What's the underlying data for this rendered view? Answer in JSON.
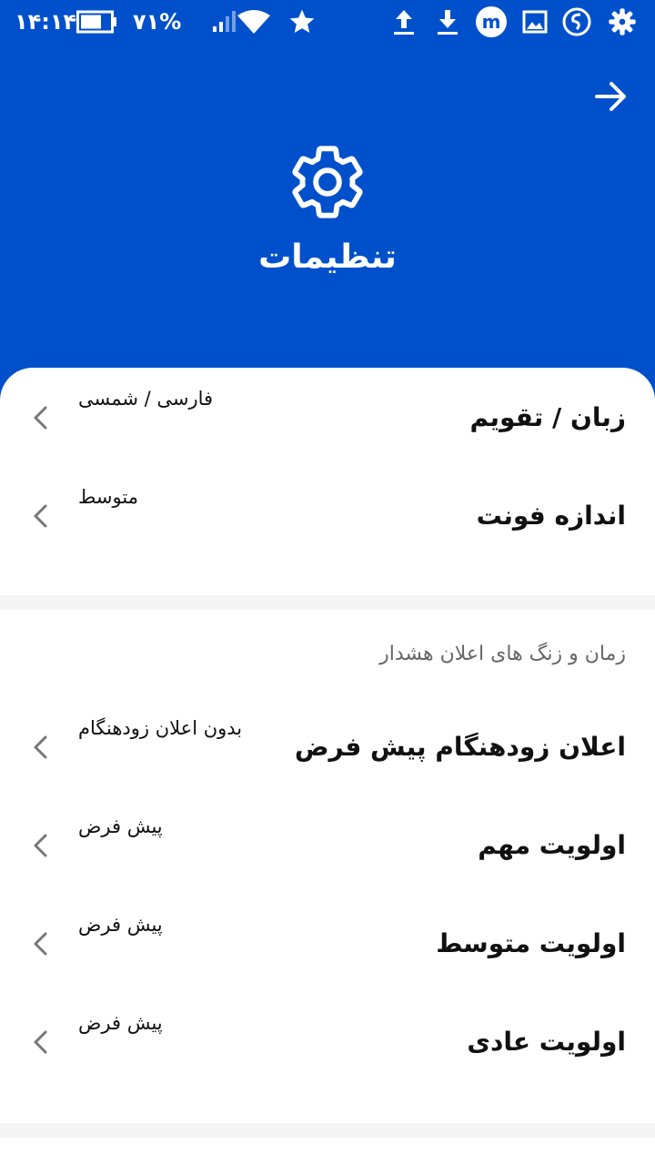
{
  "status_bar": {
    "time": "۱۴:۱۴",
    "battery_percent": "۷۱%",
    "battery_level": 0.71,
    "icons": [
      "battery-icon",
      "signal-icon",
      "wifi-icon",
      "star-icon",
      "upload-icon",
      "download-icon",
      "app-m-icon",
      "image-icon",
      "app-s-icon",
      "settings-cog-icon"
    ]
  },
  "header": {
    "title": "تنظیمات",
    "back_icon": "arrow-right-icon",
    "icon": "gear-icon",
    "color": "#0050cc"
  },
  "general": {
    "items": [
      {
        "title": "زبان / تقویم",
        "value": "فارسی / شمسی"
      },
      {
        "title": "اندازه فونت",
        "value": "متوسط"
      }
    ]
  },
  "alarms": {
    "section_title": "زمان و زنگ های اعلان هشدار",
    "items": [
      {
        "title": "اعلان زودهنگام پیش فرض",
        "value": "بدون اعلان زودهنگام"
      },
      {
        "title": "اولویت مهم",
        "value": "پیش فرض"
      },
      {
        "title": "اولویت متوسط",
        "value": "پیش فرض"
      },
      {
        "title": "اولویت عادی",
        "value": "پیش فرض"
      }
    ]
  }
}
